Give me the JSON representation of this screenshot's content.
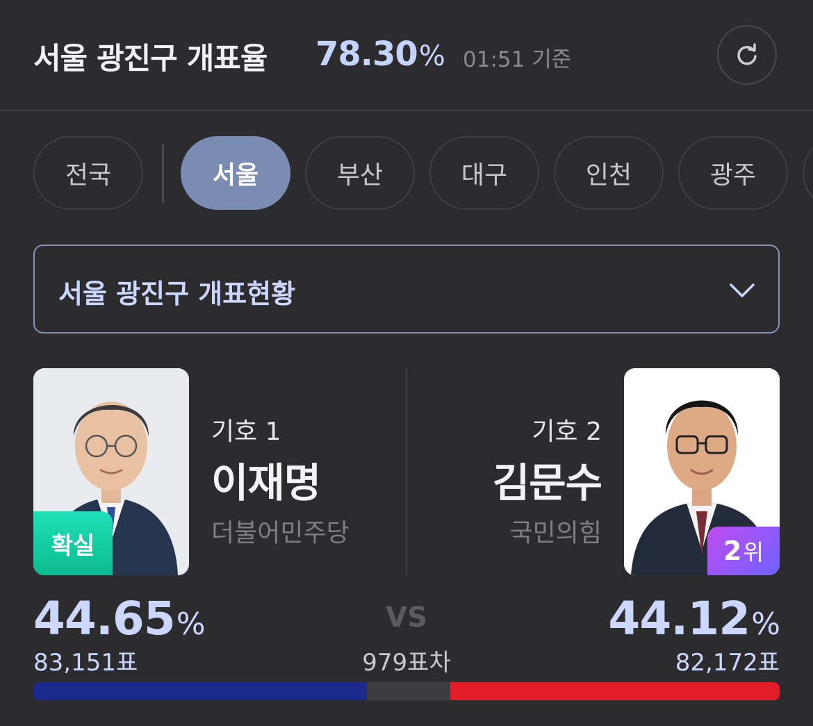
{
  "header": {
    "title": "서울 광진구 개표율",
    "rate_value": "78.30",
    "rate_unit": "%",
    "time": "01:51 기준"
  },
  "tabs": [
    {
      "label": "전국",
      "active": false
    },
    {
      "label": "서울",
      "active": true
    },
    {
      "label": "부산",
      "active": false
    },
    {
      "label": "대구",
      "active": false
    },
    {
      "label": "인천",
      "active": false
    },
    {
      "label": "광주",
      "active": false
    }
  ],
  "select": {
    "label": "서울 광진구 개표현황"
  },
  "candidates": {
    "left": {
      "number": "기호 1",
      "name": "이재명",
      "party": "더불어민주당",
      "badge": "확실",
      "percent": "44.65",
      "percent_unit": "%",
      "votes": "83,151표",
      "share": 0.4465,
      "color": "#1b2a8c"
    },
    "right": {
      "number": "기호 2",
      "name": "김문수",
      "party": "국민의힘",
      "badge_num": "2",
      "badge_unit": "위",
      "percent": "44.12",
      "percent_unit": "%",
      "votes": "82,172표",
      "share": 0.4412,
      "color": "#e21d2a"
    }
  },
  "vs": "VS",
  "diff": "979표차"
}
